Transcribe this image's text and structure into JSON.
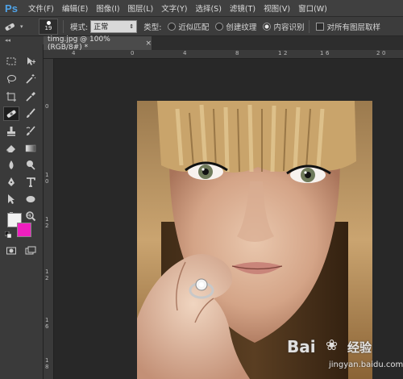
{
  "app": {
    "logo": "Ps"
  },
  "menu": [
    "文件(F)",
    "编辑(E)",
    "图像(I)",
    "图层(L)",
    "文字(Y)",
    "选择(S)",
    "滤镜(T)",
    "视图(V)",
    "窗口(W)"
  ],
  "options": {
    "brush_size": "19",
    "mode_label": "模式:",
    "mode_value": "正常",
    "type_label": "类型:",
    "type_options": [
      "近似匹配",
      "创建纹理",
      "内容识别"
    ],
    "selected_type": "内容识别",
    "sample_all_label": "对所有图层取样"
  },
  "document": {
    "tab_title": "timg.jpg @ 100%(RGB/8#) *",
    "close": "×"
  },
  "rulers": {
    "top": [
      "4",
      "0",
      "4",
      "8",
      "1",
      "2",
      "1",
      "6",
      "2",
      "0"
    ],
    "left": [
      "0",
      "1",
      "0",
      "1",
      "2",
      "1",
      "2",
      "1",
      "6",
      "1",
      "8"
    ]
  },
  "colors": {
    "foreground": "#f2f2f2",
    "background": "#ee1fbf",
    "ps_blue": "#4fa3e8"
  },
  "watermark": {
    "logo": "Bai",
    "brand": "经验",
    "url": "jingyan.baidu.com"
  }
}
